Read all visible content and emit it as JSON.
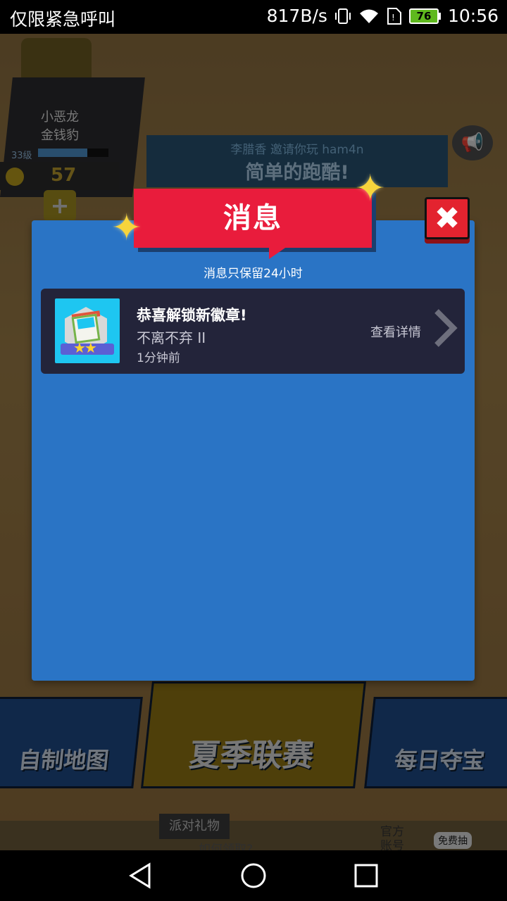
{
  "status_bar": {
    "carrier": "仅限紧急呼叫",
    "speed": "817B/s",
    "battery": "76",
    "time": "10:56"
  },
  "background": {
    "player_name": "小恶龙",
    "player_title": "金钱豹",
    "level": "33级",
    "coins": "57",
    "invite_line1": "李腊香 邀请你玩 ham4n",
    "invite_line2": "简单的跑酷!",
    "tiles": [
      "自制地图",
      "夏季联赛",
      "每日夺宝"
    ],
    "party_gift": "派对礼物",
    "how_to_get": "如何领取?",
    "official": "官方",
    "account": "账号",
    "free": "免费抽"
  },
  "modal": {
    "title": "消息",
    "subtitle": "消息只保留24小时",
    "close_label": "✖",
    "messages": [
      {
        "title": "恭喜解锁新徽章!",
        "subtitle": "不离不弃 II",
        "time": "1分钟前",
        "action": "查看详情"
      }
    ]
  },
  "colors": {
    "modal_bg": "#2a74c5",
    "ribbon": "#e91c3c",
    "message_bg": "#23243a",
    "close_button": "#e3232f"
  }
}
